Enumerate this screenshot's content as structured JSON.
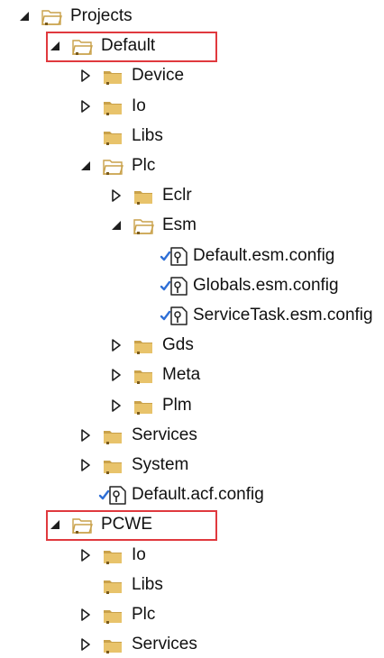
{
  "tree": [
    {
      "label": "Projects",
      "level": 0,
      "state": "expanded",
      "icon": "folder-open-icon"
    },
    {
      "label": "Default",
      "level": 1,
      "state": "expanded",
      "icon": "folder-open-icon",
      "highlighted": true
    },
    {
      "label": "Device",
      "level": 2,
      "state": "collapsed",
      "icon": "folder-icon"
    },
    {
      "label": "Io",
      "level": 2,
      "state": "collapsed",
      "icon": "folder-icon"
    },
    {
      "label": "Libs",
      "level": 2,
      "state": "leaf",
      "icon": "folder-icon"
    },
    {
      "label": "Plc",
      "level": 2,
      "state": "expanded",
      "icon": "folder-open-icon"
    },
    {
      "label": "Eclr",
      "level": 3,
      "state": "collapsed",
      "icon": "folder-icon"
    },
    {
      "label": "Esm",
      "level": 3,
      "state": "expanded",
      "icon": "folder-open-icon"
    },
    {
      "label": "Default.esm.config",
      "level": 4,
      "state": "leaf",
      "icon": "checked-config-file-icon"
    },
    {
      "label": "Globals.esm.config",
      "level": 4,
      "state": "leaf",
      "icon": "checked-config-file-icon"
    },
    {
      "label": "ServiceTask.esm.config",
      "level": 4,
      "state": "leaf",
      "icon": "checked-config-file-icon"
    },
    {
      "label": "Gds",
      "level": 3,
      "state": "collapsed",
      "icon": "folder-icon"
    },
    {
      "label": "Meta",
      "level": 3,
      "state": "collapsed",
      "icon": "folder-icon"
    },
    {
      "label": "Plm",
      "level": 3,
      "state": "collapsed",
      "icon": "folder-icon"
    },
    {
      "label": "Services",
      "level": 2,
      "state": "collapsed",
      "icon": "folder-icon"
    },
    {
      "label": "System",
      "level": 2,
      "state": "collapsed",
      "icon": "folder-icon"
    },
    {
      "label": "Default.acf.config",
      "level": 2,
      "state": "leaf",
      "icon": "checked-config-file-icon"
    },
    {
      "label": "PCWE",
      "level": 1,
      "state": "expanded",
      "icon": "folder-open-icon",
      "highlighted": true
    },
    {
      "label": "Io",
      "level": 2,
      "state": "collapsed",
      "icon": "folder-icon"
    },
    {
      "label": "Libs",
      "level": 2,
      "state": "leaf",
      "icon": "folder-icon"
    },
    {
      "label": "Plc",
      "level": 2,
      "state": "collapsed",
      "icon": "folder-icon"
    },
    {
      "label": "Services",
      "level": 2,
      "state": "collapsed",
      "icon": "folder-icon"
    }
  ],
  "colors": {
    "highlight": "#e0393e",
    "folder_front": "#e8c36b",
    "folder_back": "#c9a14a",
    "check": "#2f6fd6",
    "arrow": "#1e1e1e"
  }
}
